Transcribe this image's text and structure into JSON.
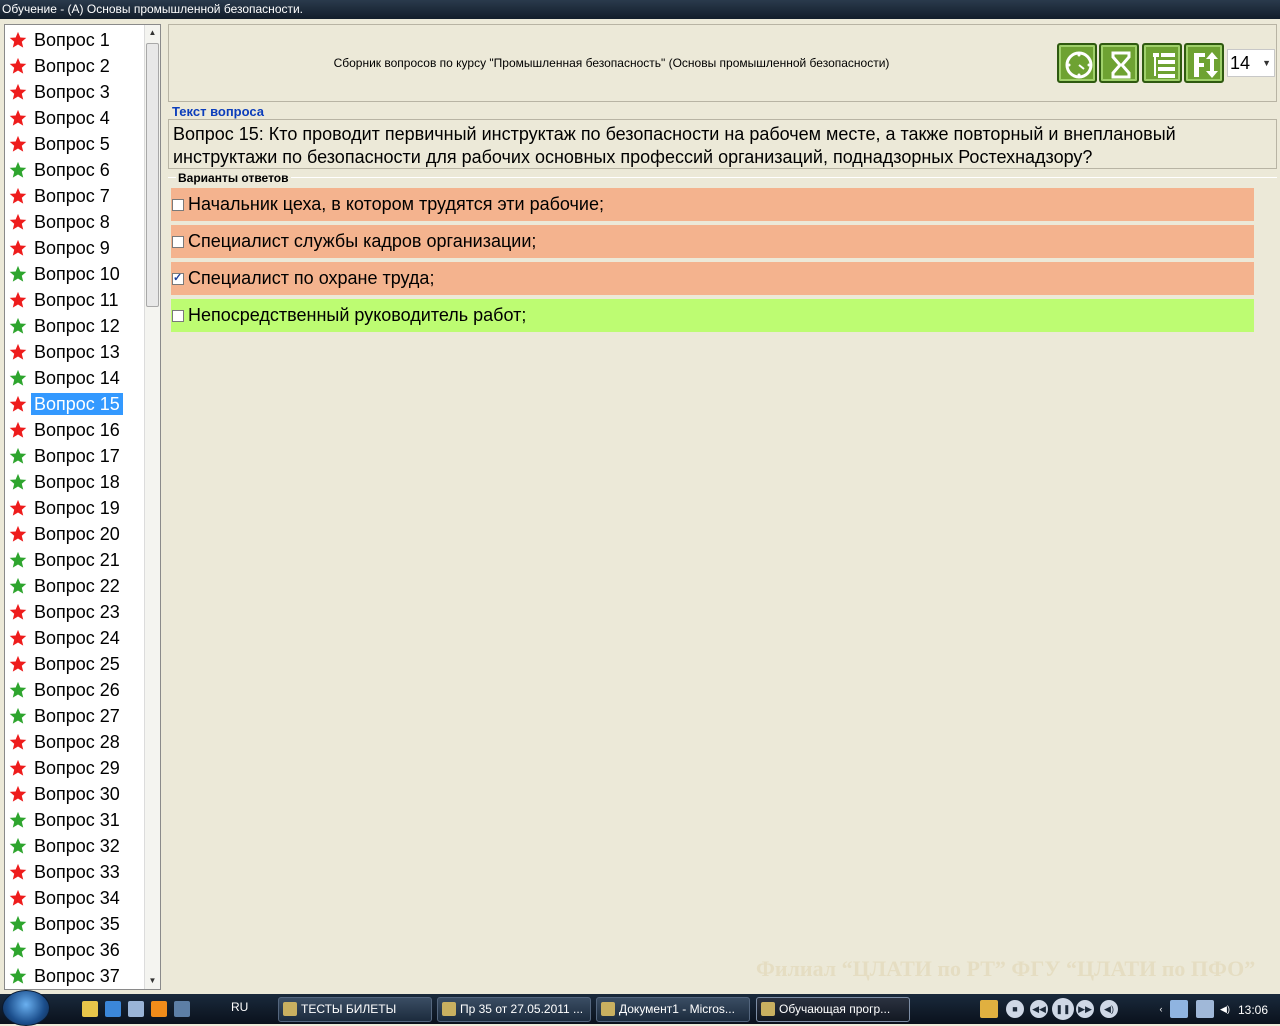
{
  "window": {
    "title": "Обучение - (А) Основы промышленной безопасности."
  },
  "questions": [
    {
      "label": "Вопрос 1",
      "status": "red"
    },
    {
      "label": "Вопрос 2",
      "status": "red"
    },
    {
      "label": "Вопрос 3",
      "status": "red"
    },
    {
      "label": "Вопрос 4",
      "status": "red"
    },
    {
      "label": "Вопрос 5",
      "status": "red"
    },
    {
      "label": "Вопрос 6",
      "status": "green"
    },
    {
      "label": "Вопрос 7",
      "status": "red"
    },
    {
      "label": "Вопрос 8",
      "status": "red"
    },
    {
      "label": "Вопрос 9",
      "status": "red"
    },
    {
      "label": "Вопрос 10",
      "status": "green"
    },
    {
      "label": "Вопрос 11",
      "status": "red"
    },
    {
      "label": "Вопрос 12",
      "status": "green"
    },
    {
      "label": "Вопрос 13",
      "status": "red"
    },
    {
      "label": "Вопрос 14",
      "status": "green"
    },
    {
      "label": "Вопрос 15",
      "status": "red",
      "selected": true
    },
    {
      "label": "Вопрос 16",
      "status": "red"
    },
    {
      "label": "Вопрос 17",
      "status": "green"
    },
    {
      "label": "Вопрос 18",
      "status": "green"
    },
    {
      "label": "Вопрос 19",
      "status": "red"
    },
    {
      "label": "Вопрос 20",
      "status": "red"
    },
    {
      "label": "Вопрос 21",
      "status": "green"
    },
    {
      "label": "Вопрос 22",
      "status": "green"
    },
    {
      "label": "Вопрос 23",
      "status": "red"
    },
    {
      "label": "Вопрос 24",
      "status": "red"
    },
    {
      "label": "Вопрос 25",
      "status": "red"
    },
    {
      "label": "Вопрос 26",
      "status": "green"
    },
    {
      "label": "Вопрос 27",
      "status": "green"
    },
    {
      "label": "Вопрос 28",
      "status": "red"
    },
    {
      "label": "Вопрос 29",
      "status": "red"
    },
    {
      "label": "Вопрос 30",
      "status": "red"
    },
    {
      "label": "Вопрос 31",
      "status": "green"
    },
    {
      "label": "Вопрос 32",
      "status": "green"
    },
    {
      "label": "Вопрос 33",
      "status": "red"
    },
    {
      "label": "Вопрос 34",
      "status": "red"
    },
    {
      "label": "Вопрос 35",
      "status": "green"
    },
    {
      "label": "Вопрос 36",
      "status": "green"
    },
    {
      "label": "Вопрос 37",
      "status": "green"
    }
  ],
  "status_colors": {
    "red": "#ee1c1c",
    "green": "#2ea52e"
  },
  "header": {
    "course": "Сборник вопросов по курсу \"Промышленная безопасность\" (Основы промышленной безопасности)",
    "toolbar": [
      {
        "name": "clock-icon"
      },
      {
        "name": "hourglass-icon"
      },
      {
        "name": "list-icon"
      },
      {
        "name": "font-size-icon"
      }
    ],
    "font_size": "14"
  },
  "question_section": {
    "label": "Текст вопроса",
    "text": "Вопрос 15: Кто проводит первичный инструктаж по безопасности на рабочем месте, а также повторный и внеплановый инструктажи по безопасности для рабочих основных профессий организаций, поднадзорных Ростехнадзору?"
  },
  "answers_section": {
    "label": "Варианты ответов",
    "answers": [
      {
        "text": "Начальник цеха, в котором трудятся эти рабочие;",
        "checked": false,
        "color": "#f4b38e"
      },
      {
        "text": "Специалист службы кадров организации;",
        "checked": false,
        "color": "#f4b38e"
      },
      {
        "text": "Специалист по охране труда;",
        "checked": true,
        "color": "#f4b38e"
      },
      {
        "text": "Непосредственный руководитель работ;",
        "checked": false,
        "color": "#bdfc72"
      }
    ]
  },
  "watermark": "Филиал “ЦЛАТИ по РТ” ФГУ “ЦЛАТИ по ПФО”",
  "taskbar": {
    "lang": "RU",
    "tasks": [
      {
        "label": "ТЕСТЫ БИЛЕТЫ"
      },
      {
        "label": "Пр 35 от 27.05.2011 ..."
      },
      {
        "label": "Документ1 - Micros..."
      },
      {
        "label": "Обучающая прогр..."
      }
    ],
    "clock": "13:06"
  }
}
